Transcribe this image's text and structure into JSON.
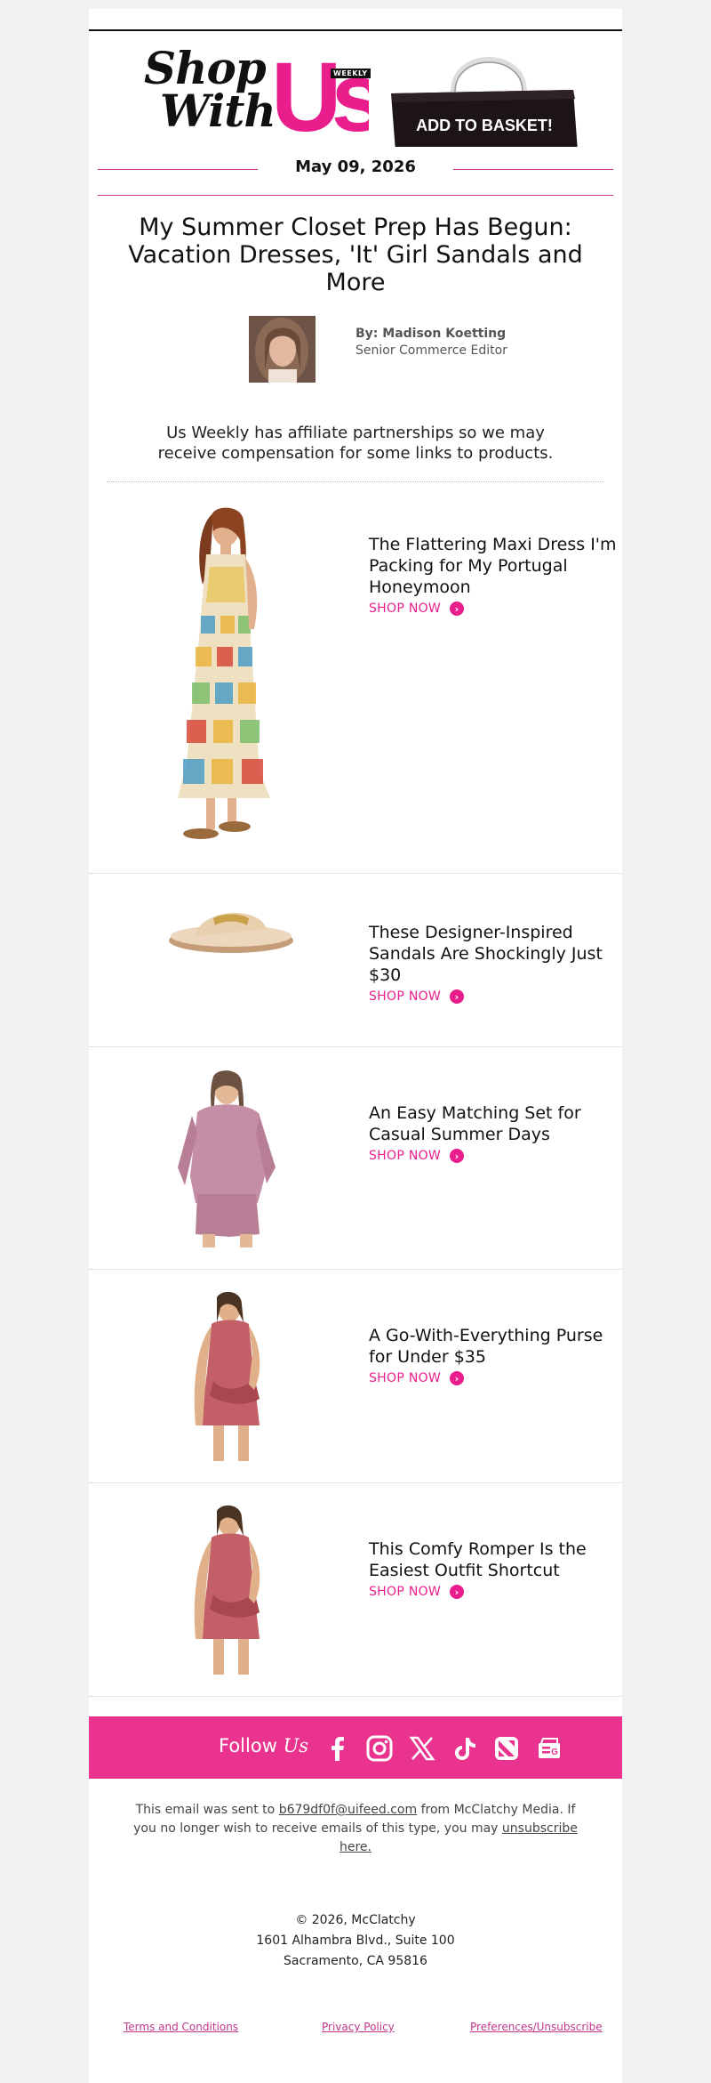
{
  "brand": {
    "shop_with_line1": "Shop",
    "shop_with_line2": "With",
    "us": "Us",
    "weekly": "WEEKLY",
    "bag_label": "ADD TO BASKET!",
    "accent": "#e91e8c"
  },
  "date": "May 09, 2026",
  "headline": "My Summer Closet Prep Has Begun: Vacation Dresses, 'It' Girl Sandals and More",
  "author": {
    "name": "By: Madison Koetting",
    "title": "Senior Commerce Editor"
  },
  "disclaimer": "Us Weekly has affiliate partnerships so we may receive compensation for some links to products.",
  "shop_label": "SHOP NOW",
  "products": [
    {
      "title": "The Flattering Maxi Dress I'm Packing for My Portugal Honeymoon"
    },
    {
      "title": "These Designer-Inspired Sandals Are Shockingly Just $30"
    },
    {
      "title": "An Easy Matching Set for Casual Summer Days"
    },
    {
      "title": "A Go-With-Everything Purse for Under $35"
    },
    {
      "title": "This Comfy Romper Is the Easiest Outfit Shortcut"
    }
  ],
  "follow": {
    "label": "Follow",
    "label_em": "Us",
    "icons": [
      "facebook-icon",
      "instagram-icon",
      "x-icon",
      "tiktok-icon",
      "apple-news-icon",
      "google-news-icon"
    ]
  },
  "footer": {
    "sent_prefix": "This email was sent to",
    "email": "b679df0f@uifeed.com",
    "sent_middle": "from McClatchy Media. If you no longer wish to receive emails of this type, you may",
    "unsubscribe": "unsubscribe here.",
    "copyright": "© 2026, McClatchy",
    "address1": "1601 Alhambra Blvd., Suite 100",
    "address2": "Sacramento, CA 95816",
    "terms": "Terms and Conditions",
    "privacy": "Privacy Policy",
    "preferences": "Preferences/Unsubscribe"
  }
}
